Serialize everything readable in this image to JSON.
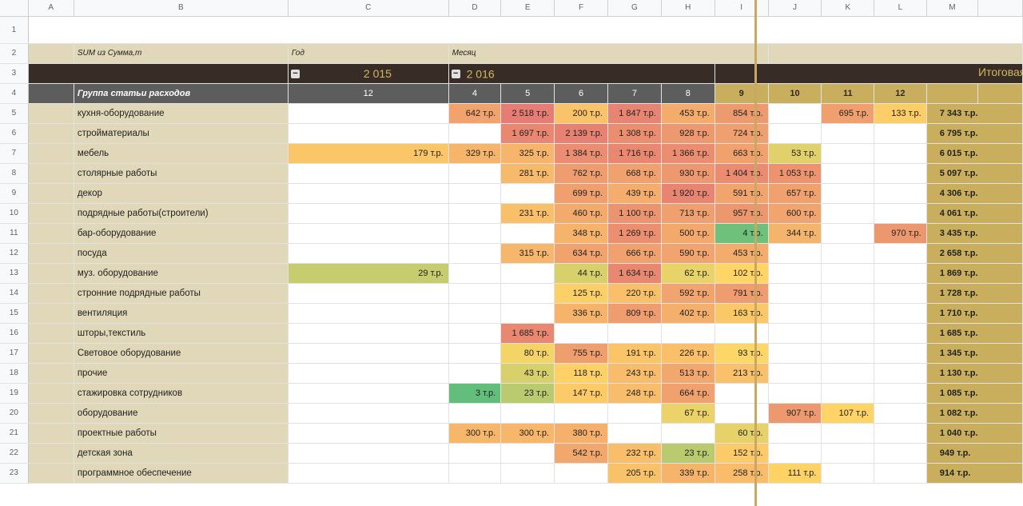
{
  "columns": [
    "A",
    "B",
    "C",
    "D",
    "E",
    "F",
    "G",
    "H",
    "I",
    "J",
    "K",
    "L",
    "M"
  ],
  "pivot": {
    "value_label": "SUM из Сумма,т",
    "year_label": "Год",
    "month_label": "Месяц",
    "year_2015": "2 015",
    "year_2016": "2 016",
    "grand_total_label": "Итоговая сумма",
    "collapse_glyph": "−",
    "row_header": "Группа статьи расходов",
    "months": [
      "12",
      "4",
      "5",
      "6",
      "7",
      "8",
      "9",
      "10",
      "11",
      "12"
    ]
  },
  "rows": [
    {
      "n": "5",
      "cat": "кухня-оборудование",
      "vals": [
        "",
        "642 т.р.",
        "2 518 т.р.",
        "200 т.р.",
        "1 847 т.р.",
        "453 т.р.",
        "854 т.р.",
        "",
        "695 т.р.",
        "133 т.р."
      ],
      "total": "7 343 т.р."
    },
    {
      "n": "6",
      "cat": "стройматериалы",
      "vals": [
        "",
        "",
        "1 697 т.р.",
        "2 139 т.р.",
        "1 308 т.р.",
        "928 т.р.",
        "724 т.р.",
        "",
        "",
        ""
      ],
      "total": "6 795 т.р."
    },
    {
      "n": "7",
      "cat": "мебель",
      "vals": [
        "179 т.р.",
        "329 т.р.",
        "325 т.р.",
        "1 384 т.р.",
        "1 716 т.р.",
        "1 366 т.р.",
        "663 т.р.",
        "53 т.р.",
        "",
        ""
      ],
      "total": "6 015 т.р."
    },
    {
      "n": "8",
      "cat": "столярные работы",
      "vals": [
        "",
        "",
        "281 т.р.",
        "762 т.р.",
        "668 т.р.",
        "930 т.р.",
        "1 404 т.р.",
        "1 053 т.р.",
        "",
        ""
      ],
      "total": "5 097 т.р."
    },
    {
      "n": "9",
      "cat": "декор",
      "vals": [
        "",
        "",
        "",
        "699 т.р.",
        "439 т.р.",
        "1 920 т.р.",
        "591 т.р.",
        "657 т.р.",
        "",
        ""
      ],
      "total": "4 306 т.р."
    },
    {
      "n": "10",
      "cat": "подрядные работы(строители)",
      "vals": [
        "",
        "",
        "231 т.р.",
        "460 т.р.",
        "1 100 т.р.",
        "713 т.р.",
        "957 т.р.",
        "600 т.р.",
        "",
        ""
      ],
      "total": "4 061 т.р."
    },
    {
      "n": "11",
      "cat": "бар-оборудование",
      "vals": [
        "",
        "",
        "",
        "348 т.р.",
        "1 269 т.р.",
        "500 т.р.",
        "4 т.р.",
        "344 т.р.",
        "",
        "970 т.р."
      ],
      "total": "3 435 т.р."
    },
    {
      "n": "12",
      "cat": "посуда",
      "vals": [
        "",
        "",
        "315 т.р.",
        "634 т.р.",
        "666 т.р.",
        "590 т.р.",
        "453 т.р.",
        "",
        "",
        ""
      ],
      "total": "2 658 т.р."
    },
    {
      "n": "13",
      "cat": "муз. оборудование",
      "vals": [
        "29 т.р.",
        "",
        "",
        "44 т.р.",
        "1 634 т.р.",
        "62 т.р.",
        "102 т.р.",
        "",
        "",
        ""
      ],
      "total": "1 869 т.р."
    },
    {
      "n": "14",
      "cat": "стронние подрядные работы",
      "vals": [
        "",
        "",
        "",
        "125 т.р.",
        "220 т.р.",
        "592 т.р.",
        "791 т.р.",
        "",
        "",
        ""
      ],
      "total": "1 728 т.р."
    },
    {
      "n": "15",
      "cat": "вентиляция",
      "vals": [
        "",
        "",
        "",
        "336 т.р.",
        "809 т.р.",
        "402 т.р.",
        "163 т.р.",
        "",
        "",
        ""
      ],
      "total": "1 710 т.р."
    },
    {
      "n": "16",
      "cat": "шторы,текстиль",
      "vals": [
        "",
        "",
        "1 685 т.р.",
        "",
        "",
        "",
        "",
        "",
        "",
        ""
      ],
      "total": "1 685 т.р."
    },
    {
      "n": "17",
      "cat": "Световое оборудование",
      "vals": [
        "",
        "",
        "80 т.р.",
        "755 т.р.",
        "191 т.р.",
        "226 т.р.",
        "93 т.р.",
        "",
        "",
        ""
      ],
      "total": "1 345 т.р."
    },
    {
      "n": "18",
      "cat": "прочие",
      "vals": [
        "",
        "",
        "43 т.р.",
        "118 т.р.",
        "243 т.р.",
        "513 т.р.",
        "213 т.р.",
        "",
        "",
        ""
      ],
      "total": "1 130 т.р."
    },
    {
      "n": "19",
      "cat": "стажировка  сотрудников",
      "vals": [
        "",
        "3 т.р.",
        "23 т.р.",
        "147 т.р.",
        "248 т.р.",
        "664 т.р.",
        "",
        "",
        "",
        ""
      ],
      "total": "1 085 т.р."
    },
    {
      "n": "20",
      "cat": "оборудование",
      "vals": [
        "",
        "",
        "",
        "",
        "",
        "67 т.р.",
        "",
        "907 т.р.",
        "107 т.р.",
        ""
      ],
      "total": "1 082 т.р."
    },
    {
      "n": "21",
      "cat": "проектные работы",
      "vals": [
        "",
        "300 т.р.",
        "300 т.р.",
        "380 т.р.",
        "",
        "",
        "60 т.р.",
        "",
        "",
        ""
      ],
      "total": "1 040 т.р."
    },
    {
      "n": "22",
      "cat": "детская зона",
      "vals": [
        "",
        "",
        "",
        "542 т.р.",
        "232 т.р.",
        "23 т.р.",
        "152 т.р.",
        "",
        "",
        ""
      ],
      "total": "949 т.р."
    },
    {
      "n": "23",
      "cat": "программное обеспечение",
      "vals": [
        "",
        "",
        "",
        "",
        "205 т.р.",
        "339 т.р.",
        "258 т.р.",
        "111 т.р.",
        "",
        ""
      ],
      "total": "914 т.р."
    }
  ],
  "colors": {
    "header_dark": "#372c26",
    "header_gold_text": "#d6b75c",
    "label_beige": "#e1d7b9",
    "subheader_grey": "#5d5d5d",
    "total_gold": "#c9ae5d",
    "scale_low": "#63be7b",
    "scale_mid": "#ffd666",
    "scale_high": "#e67c73"
  }
}
